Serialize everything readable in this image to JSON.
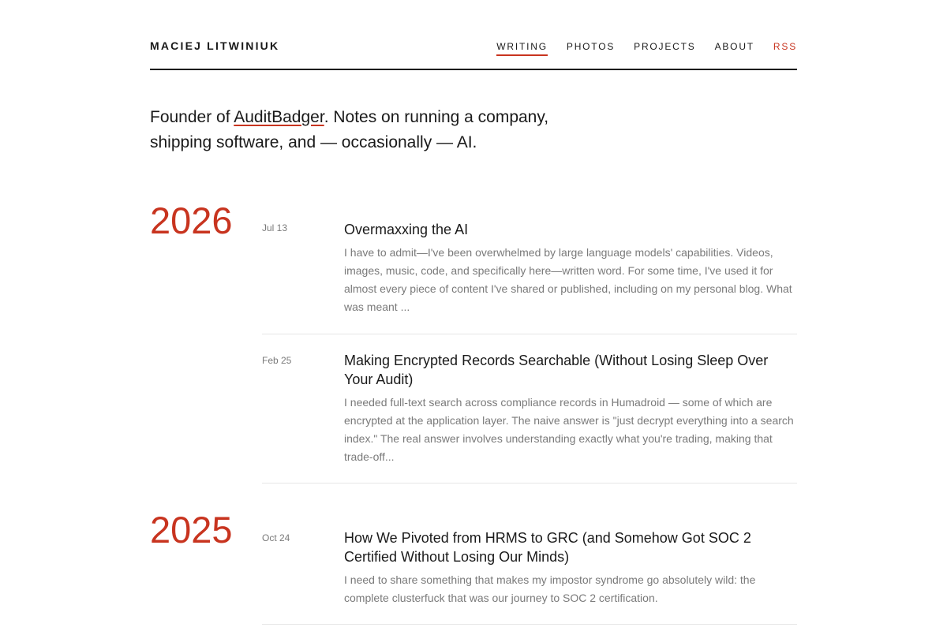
{
  "header": {
    "site_name": "MACIEJ LITWINIUK",
    "nav": [
      {
        "label": "WRITING",
        "active": true
      },
      {
        "label": "PHOTOS",
        "active": false
      },
      {
        "label": "PROJECTS",
        "active": false
      },
      {
        "label": "ABOUT",
        "active": false
      },
      {
        "label": "RSS",
        "active": false
      }
    ]
  },
  "intro": {
    "prefix": "Founder of ",
    "link": "AuditBadger",
    "suffix": ". Notes on running a company, shipping software, and — occasionally — AI."
  },
  "years": [
    {
      "year": "2026",
      "posts": [
        {
          "date": "Jul 13",
          "title": "Overmaxxing the AI",
          "excerpt": "I have to admit—I've been overwhelmed by large language models' capabilities. Videos, images, music, code, and specifically here—written word. For some time, I've used it for almost every piece of content I've shared or published, including on my personal blog. What was meant ..."
        },
        {
          "date": "Feb 25",
          "title": "Making Encrypted Records Searchable (Without Losing Sleep Over Your Audit)",
          "excerpt": "I needed full-text search across compliance records in Humadroid — some of which are encrypted at the application layer. The naive answer is \"just decrypt everything into a search index.\" The real answer involves understanding exactly what you're trading, making that trade-off..."
        }
      ]
    },
    {
      "year": "2025",
      "posts": [
        {
          "date": "Oct 24",
          "title": "How We Pivoted from HRMS to GRC (and Somehow Got SOC 2 Certified Without Losing Our Minds)",
          "excerpt": "I need to share something that makes my impostor syndrome go absolutely wild: the complete clusterfuck that was our journey to SOC 2 certification."
        }
      ]
    }
  ],
  "colors": {
    "accent": "#c8341f",
    "text": "#1a1a1a",
    "muted": "#7a7a7a",
    "divider": "#e6e6e6"
  }
}
